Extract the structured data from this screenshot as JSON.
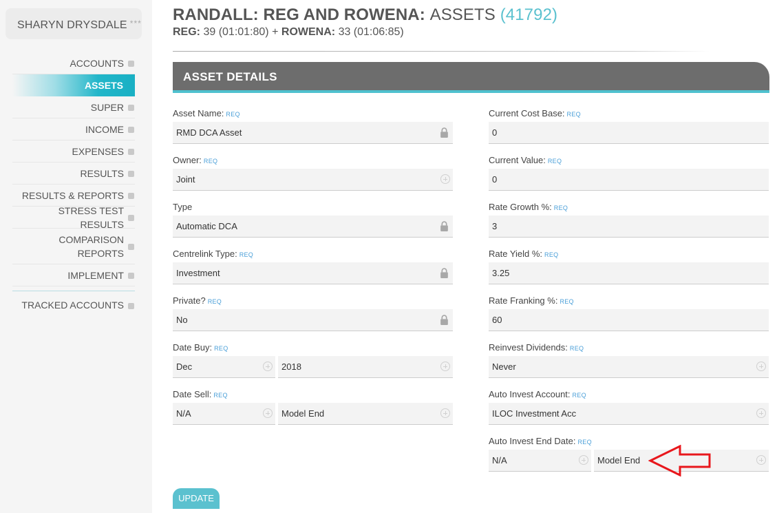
{
  "user": {
    "name": "SHARYN DRYSDALE",
    "stars": "***"
  },
  "nav": [
    {
      "label": "ACCOUNTS"
    },
    {
      "label": "ASSETS"
    },
    {
      "label": "SUPER"
    },
    {
      "label": "INCOME"
    },
    {
      "label": "EXPENSES"
    },
    {
      "label": "RESULTS"
    },
    {
      "label": "RESULTS & REPORTS"
    },
    {
      "label": "STRESS TEST RESULTS"
    },
    {
      "label": "COMPARISON REPORTS"
    },
    {
      "label": "IMPLEMENT"
    },
    {
      "label": "TRACKED ACCOUNTS"
    }
  ],
  "header": {
    "names": "RANDALL: REG AND ROWENA:",
    "section": "ASSETS",
    "count": "(41792)",
    "p1_name": "REG:",
    "p1_info": "39 (01:01:80)",
    "plus": "+",
    "p2_name": "ROWENA:",
    "p2_info": "33 (01:06:85)"
  },
  "panel": {
    "title": "ASSET DETAILS"
  },
  "req": "REQ",
  "left": {
    "asset_name": {
      "label": "Asset Name:",
      "value": "RMD DCA Asset"
    },
    "owner": {
      "label": "Owner:",
      "value": "Joint"
    },
    "type": {
      "label": "Type",
      "value": "Automatic DCA"
    },
    "centrelink": {
      "label": "Centrelink Type:",
      "value": "Investment"
    },
    "private": {
      "label": "Private?",
      "value": "No"
    },
    "date_buy": {
      "label": "Date Buy:",
      "month": "Dec",
      "year": "2018"
    },
    "date_sell": {
      "label": "Date Sell:",
      "first": "N/A",
      "second": "Model End"
    }
  },
  "right": {
    "cost_base": {
      "label": "Current Cost Base:",
      "value": "0"
    },
    "current_value": {
      "label": "Current Value:",
      "value": "0"
    },
    "rate_growth": {
      "label": "Rate Growth %:",
      "value": "3"
    },
    "rate_yield": {
      "label": "Rate Yield %:",
      "value": "3.25"
    },
    "rate_franking": {
      "label": "Rate Franking %:",
      "value": "60"
    },
    "reinvest": {
      "label": "Reinvest Dividends:",
      "value": "Never"
    },
    "auto_account": {
      "label": "Auto Invest Account:",
      "value": "ILOC Investment Acc"
    },
    "auto_end": {
      "label": "Auto Invest End Date:",
      "first": "N/A",
      "second": "Model End"
    }
  },
  "update_label": "UPDATE",
  "colors": {
    "accent": "#5bc1cf",
    "header_bg": "#6d6d6d",
    "arrow": "#e8171c",
    "req": "#4a9fd8"
  }
}
